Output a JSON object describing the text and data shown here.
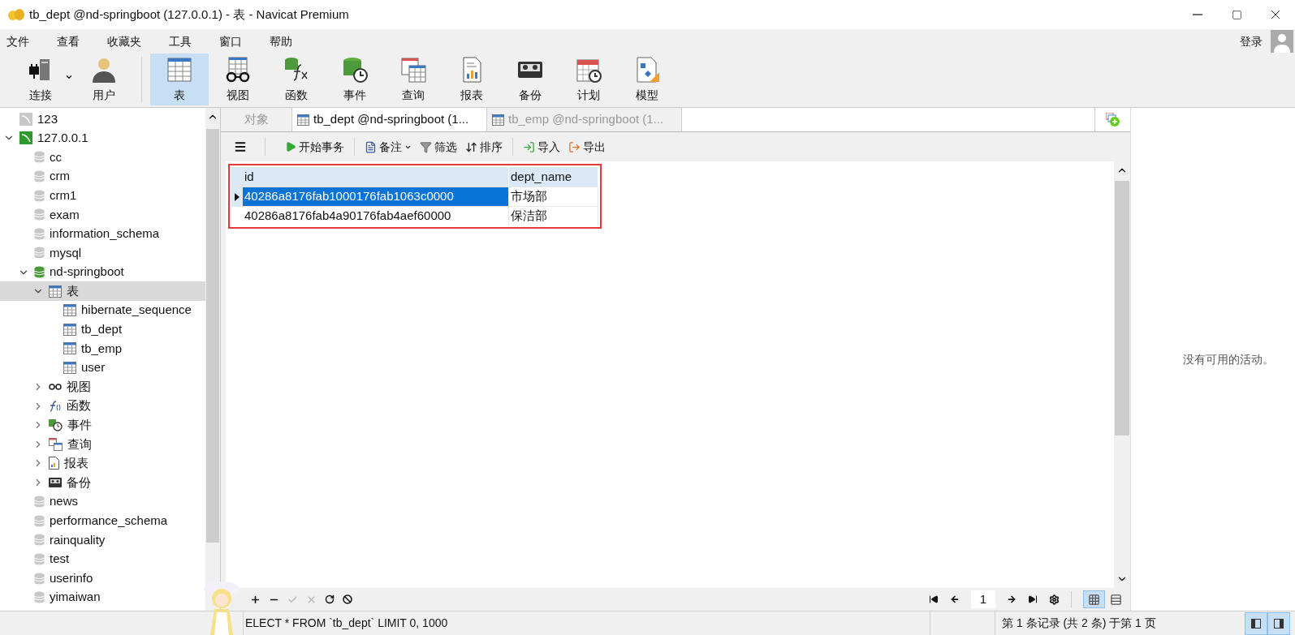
{
  "window": {
    "title": "tb_dept @nd-springboot (127.0.0.1) - 表 - Navicat Premium"
  },
  "menu": [
    "文件",
    "查看",
    "收藏夹",
    "工具",
    "窗口",
    "帮助"
  ],
  "account": {
    "label": "登录"
  },
  "toolbar": [
    {
      "label": "连接",
      "kind": "connection",
      "selected": false
    },
    {
      "label": "用户",
      "kind": "user",
      "selected": false
    },
    {
      "label": "表",
      "kind": "table",
      "selected": true
    },
    {
      "label": "视图",
      "kind": "view",
      "selected": false
    },
    {
      "label": "函数",
      "kind": "function",
      "selected": false
    },
    {
      "label": "事件",
      "kind": "event",
      "selected": false
    },
    {
      "label": "查询",
      "kind": "query",
      "selected": false
    },
    {
      "label": "报表",
      "kind": "report",
      "selected": false
    },
    {
      "label": "备份",
      "kind": "backup",
      "selected": false
    },
    {
      "label": "计划",
      "kind": "schedule",
      "selected": false
    },
    {
      "label": "模型",
      "kind": "model",
      "selected": false
    }
  ],
  "tree": [
    {
      "label": "123",
      "kind": "connection",
      "connected": false
    },
    {
      "label": "127.0.0.1",
      "kind": "connection",
      "connected": true,
      "expanded": true,
      "children": [
        {
          "label": "cc",
          "kind": "database",
          "open": false
        },
        {
          "label": "crm",
          "kind": "database",
          "open": false
        },
        {
          "label": "crm1",
          "kind": "database",
          "open": false
        },
        {
          "label": "exam",
          "kind": "database",
          "open": false
        },
        {
          "label": "information_schema",
          "kind": "database",
          "open": false
        },
        {
          "label": "mysql",
          "kind": "database",
          "open": false
        },
        {
          "label": "nd-springboot",
          "kind": "database",
          "open": true,
          "expanded": true,
          "children": [
            {
              "label": "表",
              "kind": "tables",
              "expanded": true,
              "selected": true,
              "children": [
                {
                  "label": "hibernate_sequence",
                  "kind": "table",
                  "selected": false
                },
                {
                  "label": "tb_dept",
                  "kind": "table",
                  "selected": false
                },
                {
                  "label": "tb_emp",
                  "kind": "table",
                  "selected": false
                },
                {
                  "label": "user",
                  "kind": "table",
                  "selected": false
                }
              ]
            },
            {
              "label": "视图",
              "kind": "views",
              "expanded": false,
              "selected": false
            },
            {
              "label": "函数",
              "kind": "functions",
              "expanded": false,
              "selected": false
            },
            {
              "label": "事件",
              "kind": "events",
              "expanded": false,
              "selected": false
            },
            {
              "label": "查询",
              "kind": "queries",
              "expanded": false,
              "selected": false
            },
            {
              "label": "报表",
              "kind": "reports",
              "expanded": false,
              "selected": false
            },
            {
              "label": "备份",
              "kind": "backups",
              "expanded": false,
              "selected": false
            }
          ]
        },
        {
          "label": "news",
          "kind": "database",
          "open": false
        },
        {
          "label": "performance_schema",
          "kind": "database",
          "open": false
        },
        {
          "label": "rainquality",
          "kind": "database",
          "open": false
        },
        {
          "label": "test",
          "kind": "database",
          "open": false
        },
        {
          "label": "userinfo",
          "kind": "database",
          "open": false
        },
        {
          "label": "yimaiwan",
          "kind": "database",
          "open": false
        }
      ]
    }
  ],
  "tabs": [
    {
      "label": "对象",
      "kind": "objects",
      "selected": false
    },
    {
      "label": "tb_dept @nd-springboot (1...",
      "kind": "table",
      "selected": true
    },
    {
      "label": "tb_emp @nd-springboot (1...",
      "kind": "table",
      "selected": false
    }
  ],
  "data_toolbar": [
    {
      "label": "开始事务",
      "kind": "transaction"
    },
    {
      "label": "备注",
      "kind": "memo"
    },
    {
      "label": "筛选",
      "kind": "filter"
    },
    {
      "label": "排序",
      "kind": "sort"
    },
    {
      "label": "导入",
      "kind": "import"
    },
    {
      "label": "导出",
      "kind": "export"
    }
  ],
  "table": {
    "columns": [
      "id",
      "dept_name"
    ],
    "rows": [
      {
        "cells": [
          "40286a8176fab1000176fab1063c0000",
          "市场部"
        ],
        "selected": true
      },
      {
        "cells": [
          "40286a8176fab4a90176fab4aef60000",
          "保洁部"
        ],
        "selected": false
      }
    ]
  },
  "pager": {
    "page": "1"
  },
  "status_bar": {
    "sql": "ELECT * FROM `tb_dept` LIMIT 0, 1000",
    "records": "第 1 条记录 (共 2 条) 于第 1 页"
  },
  "info_panel": {
    "message": "没有可用的活动。"
  }
}
